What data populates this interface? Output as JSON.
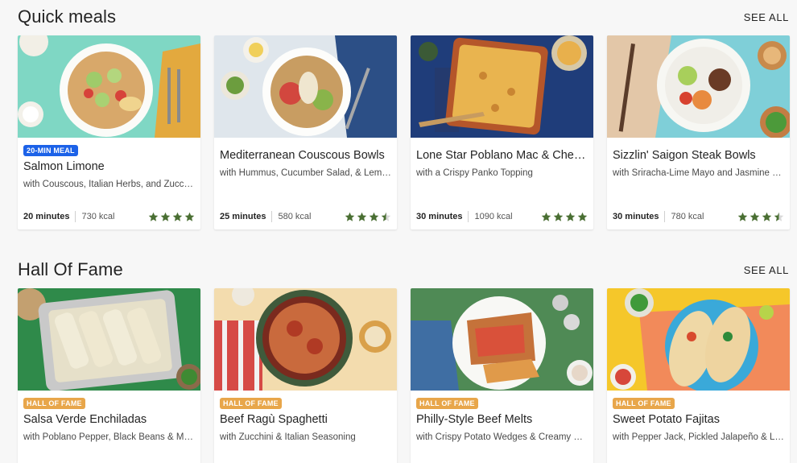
{
  "sections": [
    {
      "title": "Quick meals",
      "see_all": "SEE ALL",
      "cards": [
        {
          "badge": "20-MIN MEAL",
          "badge_color": "#1c62e8",
          "title": "Salmon Limone",
          "subtitle": "with Couscous, Italian Herbs, and Zucchini",
          "minutes": "20 minutes",
          "kcal": "730 kcal",
          "rating": 4.5
        },
        {
          "badge": "",
          "title": "Mediterranean Couscous Bowls",
          "subtitle": "with Hummus, Cucumber Salad, & Lemon Yogurt",
          "minutes": "25 minutes",
          "kcal": "580 kcal",
          "rating": 3.5
        },
        {
          "badge": "",
          "title": "Lone Star Poblano Mac & Cheese",
          "subtitle": "with a Crispy Panko Topping",
          "minutes": "30 minutes",
          "kcal": "1090 kcal",
          "rating": 4.5
        },
        {
          "badge": "",
          "title": "Sizzlin' Saigon Steak Bowls",
          "subtitle": "with Sriracha-Lime Mayo and Jasmine Rice",
          "minutes": "30 minutes",
          "kcal": "780 kcal",
          "rating": 3.5
        }
      ]
    },
    {
      "title": "Hall Of Fame",
      "see_all": "SEE ALL",
      "cards": [
        {
          "badge": "HALL OF FAME",
          "badge_color": "#e8a64a",
          "title": "Salsa Verde Enchiladas",
          "subtitle": "with Poblano Pepper, Black Beans & Monterey Jack"
        },
        {
          "badge": "HALL OF FAME",
          "badge_color": "#e8a64a",
          "title": "Beef Ragù Spaghetti",
          "subtitle": "with Zucchini & Italian Seasoning"
        },
        {
          "badge": "HALL OF FAME",
          "badge_color": "#e8a64a",
          "title": "Philly-Style Beef Melts",
          "subtitle": "with Crispy Potato Wedges & Creamy Mushroom Sauce"
        },
        {
          "badge": "HALL OF FAME",
          "badge_color": "#e8a64a",
          "title": "Sweet Potato Fajitas",
          "subtitle": "with Pepper Jack, Pickled Jalapeño & Lime Crema"
        }
      ]
    }
  ],
  "colors": {
    "star": "#4a6f33",
    "star_empty": "#d8d8d8"
  }
}
